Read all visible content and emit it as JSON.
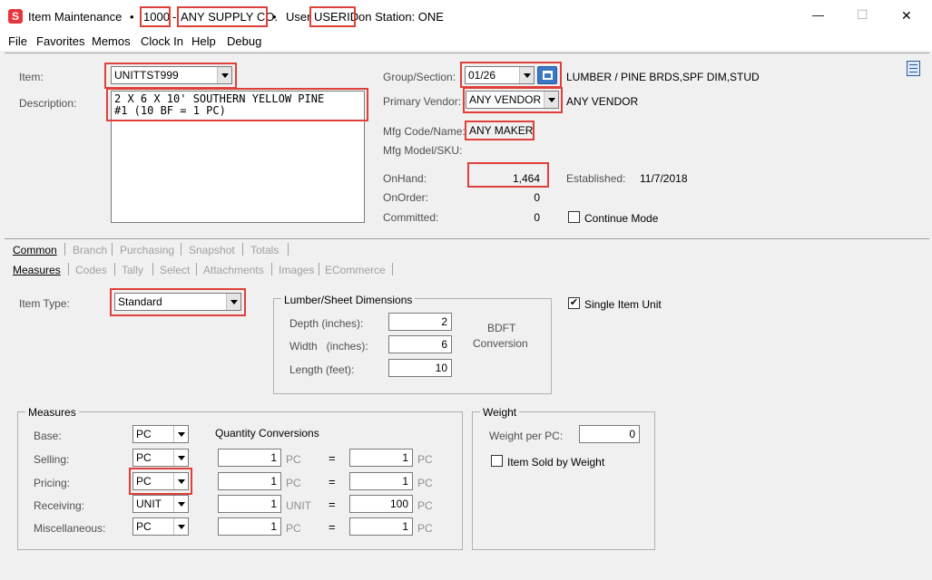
{
  "window": {
    "title_app": "Item Maintenance",
    "sep1": "•",
    "company_code": "1000",
    "dash": "-",
    "company_name": "ANY SUPPLY CO.",
    "sep2": "•",
    "user_label": "User",
    "user_id": "USERID",
    "station": "on Station: ONE",
    "minimize": "—",
    "maximize": "☐",
    "close": "✕"
  },
  "menu": [
    "File",
    "Favorites",
    "Memos",
    "Clock In",
    "Help",
    "Debug"
  ],
  "item": {
    "item_label": "Item:",
    "item_value": "UNITTST999",
    "description_label": "Description:",
    "description_line1": "2 X 6 X 10' SOUTHERN YELLOW PINE",
    "description_line2": "#1 (10 BF = 1 PC)",
    "group_label": "Group/Section:",
    "group_value": "01/26",
    "group_desc": "LUMBER / PINE BRDS,SPF DIM,STUD",
    "vendor_label": "Primary Vendor:",
    "vendor_value": "ANY VENDOR",
    "vendor_desc": "ANY VENDOR",
    "mfg_label": "Mfg Code/Name:",
    "mfg_value": "ANY MAKER",
    "model_label": "Mfg Model/SKU:",
    "onhand_label": "OnHand:",
    "onhand_value": "1,464",
    "onorder_label": "OnOrder:",
    "onorder_value": "0",
    "committed_label": "Committed:",
    "committed_value": "0",
    "established_label": "Established:",
    "established_value": "11/7/2018",
    "continue_mode_label": "Continue Mode"
  },
  "tabs_main": [
    "Common",
    "Branch",
    "Purchasing",
    "Snapshot",
    "Totals"
  ],
  "tabs_sub": [
    "Measures",
    "Codes",
    "Tally",
    "Select",
    "Attachments",
    "Images",
    "ECommerce"
  ],
  "measures": {
    "item_type_label": "Item Type:",
    "item_type_value": "Standard",
    "lumber_group": "Lumber/Sheet Dimensions",
    "depth_label": "Depth (inches):",
    "depth_value": "2",
    "width_label": "Width   (inches):",
    "width_value": "6",
    "length_label": "Length (feet):",
    "length_value": "10",
    "bdft_line1": "BDFT",
    "bdft_line2": "Conversion",
    "single_unit_label": "Single Item Unit",
    "measures_group": "Measures",
    "qty_conv_label": "Quantity Conversions",
    "rows": [
      {
        "label": "Base:",
        "unit": "PC"
      },
      {
        "label": "Selling:",
        "unit": "PC",
        "q1": "1",
        "u1": "PC",
        "q2": "1",
        "u2": "PC"
      },
      {
        "label": "Pricing:",
        "unit": "PC",
        "q1": "1",
        "u1": "PC",
        "q2": "1",
        "u2": "PC"
      },
      {
        "label": "Receiving:",
        "unit": "UNIT",
        "q1": "1",
        "u1": "UNIT",
        "q2": "100",
        "u2": "PC"
      },
      {
        "label": "Miscellaneous:",
        "unit": "PC",
        "q1": "1",
        "u1": "PC",
        "q2": "1",
        "u2": "PC"
      }
    ],
    "eq": "=",
    "weight_group": "Weight",
    "weight_label": "Weight per PC:",
    "weight_value": "0",
    "sold_by_weight_label": "Item Sold by Weight"
  },
  "colors": {
    "highlight": "#e0403a",
    "app_icon": "#e8353c"
  }
}
